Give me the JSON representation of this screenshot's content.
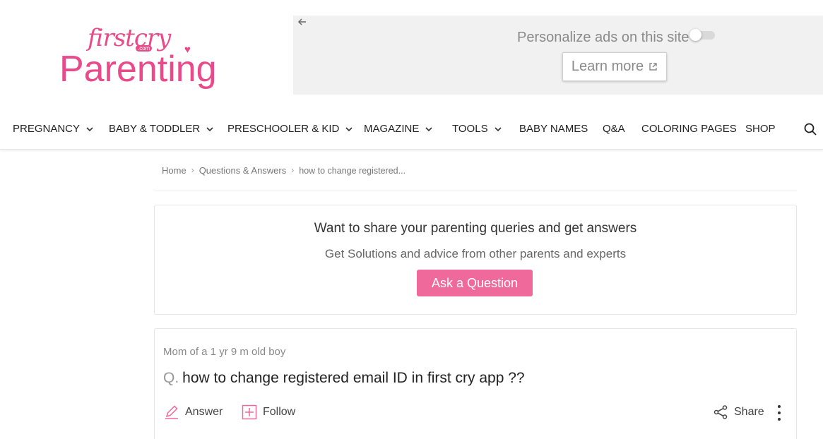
{
  "brand": {
    "small": "firstcry",
    "com": ".com",
    "big": "Parenting"
  },
  "ad": {
    "personalize_text": "Personalize ads on this site",
    "learn_more": "Learn more",
    "toggle_on": false
  },
  "nav": {
    "items": [
      {
        "label": "PREGNANCY",
        "has_dropdown": true
      },
      {
        "label": "BABY & TODDLER",
        "has_dropdown": true
      },
      {
        "label": "PRESCHOOLER & KID",
        "has_dropdown": true
      },
      {
        "label": "MAGAZINE",
        "has_dropdown": true
      },
      {
        "label": "TOOLS",
        "has_dropdown": true
      },
      {
        "label": "BABY NAMES",
        "has_dropdown": false
      },
      {
        "label": "Q&A",
        "has_dropdown": false
      },
      {
        "label": "COLORING PAGES",
        "has_dropdown": false
      },
      {
        "label": "SHOP",
        "has_dropdown": false
      }
    ]
  },
  "breadcrumb": [
    "Home",
    "Questions & Answers",
    "how to change registered..."
  ],
  "ask_card": {
    "title": "Want to share your parenting queries and get answers",
    "subtitle": "Get Solutions and advice from other parents and experts",
    "button": "Ask a Question"
  },
  "question": {
    "meta": "Mom of a 1 yr 9 m old boy",
    "prefix": "Q.",
    "text": "how to change registered email ID in first cry app ??",
    "answer_label": "Answer",
    "follow_label": "Follow",
    "share_label": "Share"
  },
  "colors": {
    "brand_pink": "#e94b8a",
    "button_pink": "#f0699b"
  }
}
